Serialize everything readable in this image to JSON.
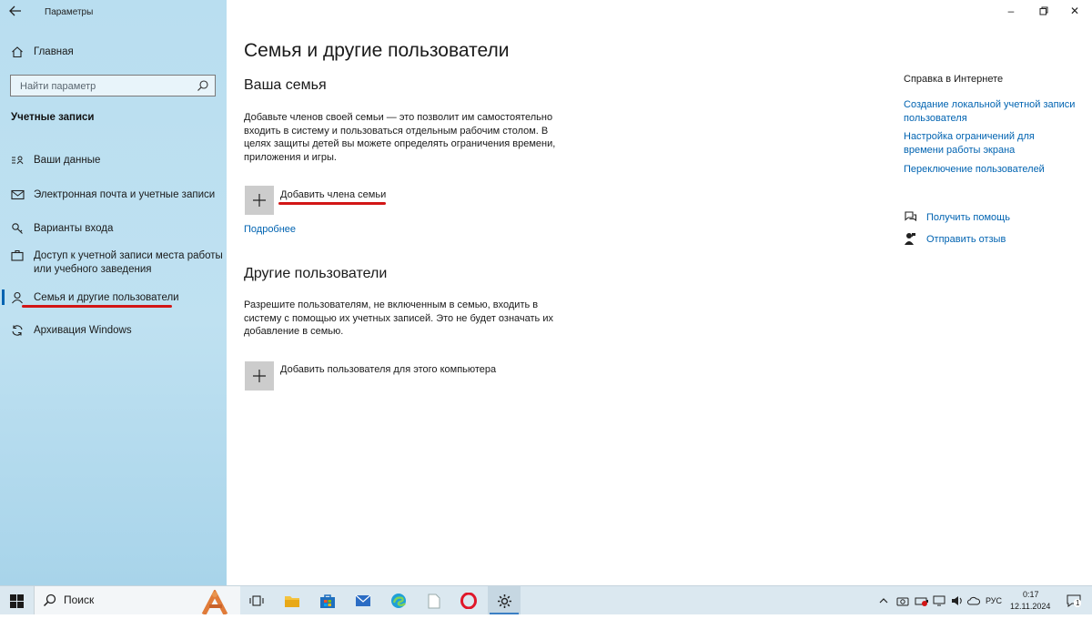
{
  "window": {
    "title": "Параметры",
    "controls": {
      "minimize": "–",
      "maximize": "☐",
      "close": "✕"
    }
  },
  "sidebar": {
    "home_label": "Главная",
    "search_placeholder": "Найти параметр",
    "section_heading": "Учетные записи",
    "items": [
      {
        "label": "Ваши данные",
        "icon": "person-card-icon"
      },
      {
        "label": "Электронная почта и учетные записи",
        "icon": "mail-icon"
      },
      {
        "label": "Варианты входа",
        "icon": "key-icon"
      },
      {
        "label": "Доступ к учетной записи места работы\nили учебного заведения",
        "icon": "briefcase-icon"
      },
      {
        "label": "Семья и другие пользователи",
        "icon": "person-icon",
        "active": true
      },
      {
        "label": "Архивация Windows",
        "icon": "sync-icon"
      }
    ]
  },
  "main": {
    "title": "Семья и другие пользователи",
    "family": {
      "heading": "Ваша семья",
      "description": "Добавьте членов своей семьи — это позволит им самостоятельно входить в систему и пользоваться отдельным рабочим столом. В целях защиты детей вы можете определять ограничения времени, приложения и игры.",
      "add_label": "Добавить члена семьи",
      "more_link": "Подробнее"
    },
    "others": {
      "heading": "Другие пользователи",
      "description": "Разрешите пользователям, не включенным в семью, входить в систему с помощью их учетных записей. Это не будет означать их добавление в семью.",
      "add_label": "Добавить пользователя для этого компьютера"
    }
  },
  "help_panel": {
    "heading": "Справка в Интернете",
    "links": [
      "Создание локальной учетной записи\nпользователя",
      "Настройка ограничений для\nвремени работы экрана",
      "Переключение пользователей"
    ],
    "get_help": "Получить помощь",
    "feedback": "Отправить отзыв"
  },
  "taskbar": {
    "search_text": "Поиск",
    "language": "РУС",
    "time": "0:17",
    "date": "12.11.2024",
    "notification_count": "1"
  },
  "colors": {
    "accent": "#0063b1",
    "annotation_red": "#d21616",
    "sidebar_bg": "#bfe1f1"
  }
}
